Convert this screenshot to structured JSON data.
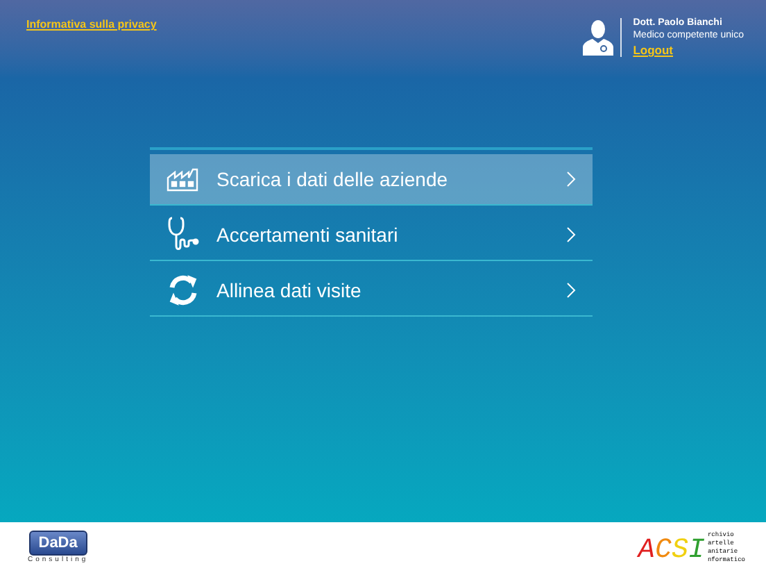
{
  "header": {
    "privacy_link": "Informativa sulla privacy",
    "user": {
      "name": "Dott. Paolo Bianchi",
      "role": "Medico competente unico",
      "logout": "Logout"
    }
  },
  "menu": [
    {
      "kind": "factory",
      "label": "Scarica i dati delle aziende",
      "selected": true
    },
    {
      "kind": "stethoscope",
      "label": "Accertamenti sanitari",
      "selected": false
    },
    {
      "kind": "sync",
      "label": "Allinea dati visite",
      "selected": false
    }
  ],
  "footer": {
    "left_logo": {
      "mark": "DaDa",
      "subtitle": "Consulting"
    },
    "right_logo": {
      "letters": [
        "A",
        "C",
        "S",
        "I"
      ],
      "words": [
        "rchivio",
        "artelle",
        "anitarie",
        "nformatico"
      ]
    }
  }
}
